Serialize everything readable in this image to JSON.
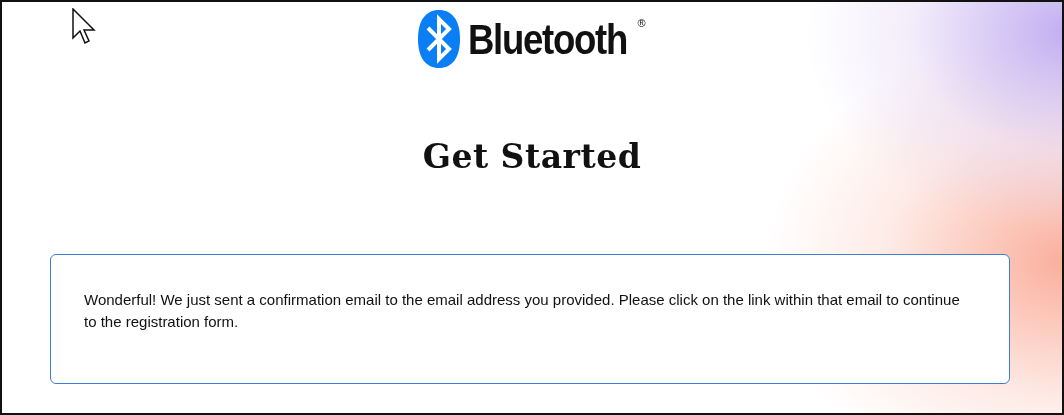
{
  "header": {
    "logo_text": "Bluetooth",
    "logo_mark": "®"
  },
  "heading": "Get Started",
  "message": "Wonderful! We just sent a confirmation email to the email address you provided. Please click on the link within that email to continue to the registration form."
}
